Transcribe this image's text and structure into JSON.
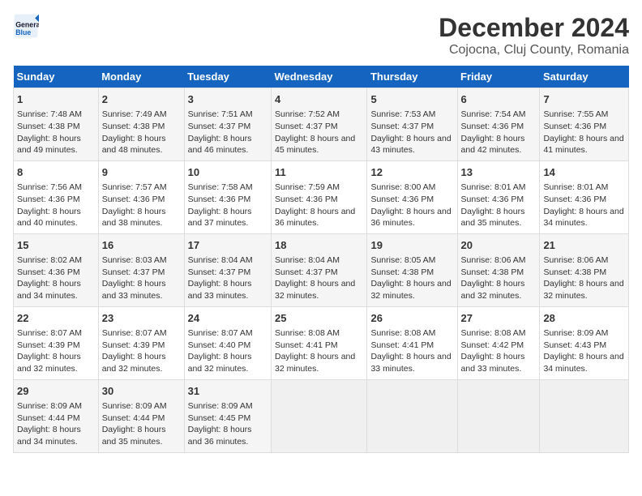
{
  "logo": {
    "line1": "General",
    "line2": "Blue"
  },
  "title": "December 2024",
  "subtitle": "Cojocna, Cluj County, Romania",
  "days_of_week": [
    "Sunday",
    "Monday",
    "Tuesday",
    "Wednesday",
    "Thursday",
    "Friday",
    "Saturday"
  ],
  "weeks": [
    [
      {
        "day": "1",
        "sunrise": "7:48 AM",
        "sunset": "4:38 PM",
        "daylight": "8 hours and 49 minutes."
      },
      {
        "day": "2",
        "sunrise": "7:49 AM",
        "sunset": "4:38 PM",
        "daylight": "8 hours and 48 minutes."
      },
      {
        "day": "3",
        "sunrise": "7:51 AM",
        "sunset": "4:37 PM",
        "daylight": "8 hours and 46 minutes."
      },
      {
        "day": "4",
        "sunrise": "7:52 AM",
        "sunset": "4:37 PM",
        "daylight": "8 hours and 45 minutes."
      },
      {
        "day": "5",
        "sunrise": "7:53 AM",
        "sunset": "4:37 PM",
        "daylight": "8 hours and 43 minutes."
      },
      {
        "day": "6",
        "sunrise": "7:54 AM",
        "sunset": "4:36 PM",
        "daylight": "8 hours and 42 minutes."
      },
      {
        "day": "7",
        "sunrise": "7:55 AM",
        "sunset": "4:36 PM",
        "daylight": "8 hours and 41 minutes."
      }
    ],
    [
      {
        "day": "8",
        "sunrise": "7:56 AM",
        "sunset": "4:36 PM",
        "daylight": "8 hours and 40 minutes."
      },
      {
        "day": "9",
        "sunrise": "7:57 AM",
        "sunset": "4:36 PM",
        "daylight": "8 hours and 38 minutes."
      },
      {
        "day": "10",
        "sunrise": "7:58 AM",
        "sunset": "4:36 PM",
        "daylight": "8 hours and 37 minutes."
      },
      {
        "day": "11",
        "sunrise": "7:59 AM",
        "sunset": "4:36 PM",
        "daylight": "8 hours and 36 minutes."
      },
      {
        "day": "12",
        "sunrise": "8:00 AM",
        "sunset": "4:36 PM",
        "daylight": "8 hours and 36 minutes."
      },
      {
        "day": "13",
        "sunrise": "8:01 AM",
        "sunset": "4:36 PM",
        "daylight": "8 hours and 35 minutes."
      },
      {
        "day": "14",
        "sunrise": "8:01 AM",
        "sunset": "4:36 PM",
        "daylight": "8 hours and 34 minutes."
      }
    ],
    [
      {
        "day": "15",
        "sunrise": "8:02 AM",
        "sunset": "4:36 PM",
        "daylight": "8 hours and 34 minutes."
      },
      {
        "day": "16",
        "sunrise": "8:03 AM",
        "sunset": "4:37 PM",
        "daylight": "8 hours and 33 minutes."
      },
      {
        "day": "17",
        "sunrise": "8:04 AM",
        "sunset": "4:37 PM",
        "daylight": "8 hours and 33 minutes."
      },
      {
        "day": "18",
        "sunrise": "8:04 AM",
        "sunset": "4:37 PM",
        "daylight": "8 hours and 32 minutes."
      },
      {
        "day": "19",
        "sunrise": "8:05 AM",
        "sunset": "4:38 PM",
        "daylight": "8 hours and 32 minutes."
      },
      {
        "day": "20",
        "sunrise": "8:06 AM",
        "sunset": "4:38 PM",
        "daylight": "8 hours and 32 minutes."
      },
      {
        "day": "21",
        "sunrise": "8:06 AM",
        "sunset": "4:38 PM",
        "daylight": "8 hours and 32 minutes."
      }
    ],
    [
      {
        "day": "22",
        "sunrise": "8:07 AM",
        "sunset": "4:39 PM",
        "daylight": "8 hours and 32 minutes."
      },
      {
        "day": "23",
        "sunrise": "8:07 AM",
        "sunset": "4:39 PM",
        "daylight": "8 hours and 32 minutes."
      },
      {
        "day": "24",
        "sunrise": "8:07 AM",
        "sunset": "4:40 PM",
        "daylight": "8 hours and 32 minutes."
      },
      {
        "day": "25",
        "sunrise": "8:08 AM",
        "sunset": "4:41 PM",
        "daylight": "8 hours and 32 minutes."
      },
      {
        "day": "26",
        "sunrise": "8:08 AM",
        "sunset": "4:41 PM",
        "daylight": "8 hours and 33 minutes."
      },
      {
        "day": "27",
        "sunrise": "8:08 AM",
        "sunset": "4:42 PM",
        "daylight": "8 hours and 33 minutes."
      },
      {
        "day": "28",
        "sunrise": "8:09 AM",
        "sunset": "4:43 PM",
        "daylight": "8 hours and 34 minutes."
      }
    ],
    [
      {
        "day": "29",
        "sunrise": "8:09 AM",
        "sunset": "4:44 PM",
        "daylight": "8 hours and 34 minutes."
      },
      {
        "day": "30",
        "sunrise": "8:09 AM",
        "sunset": "4:44 PM",
        "daylight": "8 hours and 35 minutes."
      },
      {
        "day": "31",
        "sunrise": "8:09 AM",
        "sunset": "4:45 PM",
        "daylight": "8 hours and 36 minutes."
      },
      null,
      null,
      null,
      null
    ]
  ]
}
